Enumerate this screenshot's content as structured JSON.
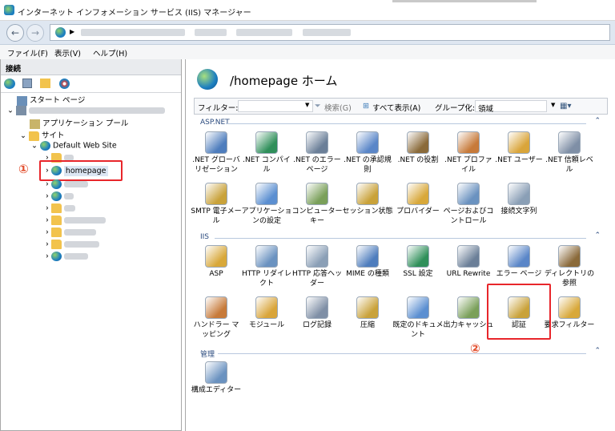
{
  "window": {
    "title": "インターネット インフォメーション サービス (IIS) マネージャー"
  },
  "menu": [
    "ファイル(F)",
    "表示(V)",
    "ヘルプ(H)"
  ],
  "connections": {
    "header": "接続",
    "start_page": "スタート ページ",
    "app_pools": "アプリケーション プール",
    "sites": "サイト",
    "default_site": "Default Web Site",
    "homepage": "homepage"
  },
  "annotations": {
    "one": "①",
    "two": "②"
  },
  "main": {
    "title": "/homepage ホーム",
    "filter_label": "フィルター:",
    "search_label": "検索(G)",
    "show_all": "すべて表示(A)",
    "group_by": "グループ化:",
    "group_value": "領域",
    "groups": {
      "aspnet": {
        "label": "ASP.NET",
        "items": [
          ".NET グローバリゼーション",
          ".NET コンパイル",
          ".NET のエラー ページ",
          ".NET の承認規則",
          ".NET の役割",
          ".NET プロファイル",
          ".NET ユーザー",
          ".NET 信頼レベル",
          "SMTP 電子メール",
          "アプリケーションの設定",
          "コンピューター キー",
          "セッション状態",
          "プロバイダー",
          "ページおよびコントロール",
          "接続文字列"
        ]
      },
      "iis": {
        "label": "IIS",
        "items": [
          "ASP",
          "HTTP リダイレクト",
          "HTTP 応答ヘッダー",
          "MIME の種類",
          "SSL 設定",
          "URL Rewrite",
          "エラー ページ",
          "ディレクトリの参照",
          "ハンドラー マッピング",
          "モジュール",
          "ログ記録",
          "圧縮",
          "既定のドキュメント",
          "出力キャッシュ",
          "認証",
          "要求フィルター"
        ]
      },
      "mgmt": {
        "label": "管理",
        "items": [
          "構成エディター"
        ]
      }
    }
  },
  "colors": {
    "highlight": "#e8262b",
    "group_text": "#2a4a7e"
  }
}
